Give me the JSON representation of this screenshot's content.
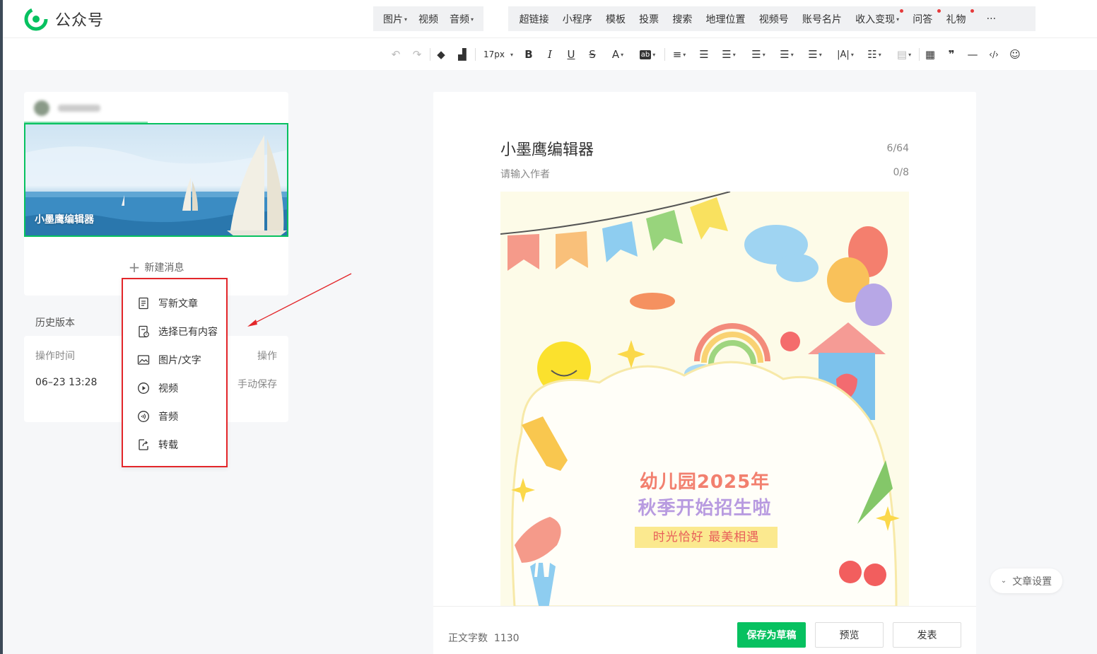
{
  "brand": {
    "name": "公众号",
    "color": "#07c160"
  },
  "media_menu": [
    "图片",
    "视频",
    "音频"
  ],
  "media_has_dropdown": [
    true,
    false,
    true
  ],
  "insert_menu": [
    {
      "label": "超链接",
      "dot": false
    },
    {
      "label": "小程序",
      "dot": false
    },
    {
      "label": "模板",
      "dot": false
    },
    {
      "label": "投票",
      "dot": false
    },
    {
      "label": "搜索",
      "dot": false
    },
    {
      "label": "地理位置",
      "dot": false
    },
    {
      "label": "视频号",
      "dot": false
    },
    {
      "label": "账号名片",
      "dot": false
    },
    {
      "label": "收入变现",
      "dot": true
    },
    {
      "label": "问答",
      "dot": true
    },
    {
      "label": "礼物",
      "dot": true
    },
    {
      "label": "···",
      "dot": false
    }
  ],
  "toolbar": {
    "font_size": "17px"
  },
  "left_panel": {
    "cover_title": "小墨鹰编辑器",
    "new_message": "新建消息",
    "history_title": "历史版本",
    "history": {
      "col_time": "操作时间",
      "col_action": "操作",
      "rows": [
        {
          "time": "06–23 13:28",
          "action": "手动保存"
        }
      ]
    }
  },
  "dropdown": {
    "items": [
      {
        "icon": "document-icon",
        "label": "写新文章"
      },
      {
        "icon": "select-content-icon",
        "label": "选择已有内容"
      },
      {
        "icon": "image-icon",
        "label": "图片/文字"
      },
      {
        "icon": "video-play-icon",
        "label": "视频"
      },
      {
        "icon": "audio-icon",
        "label": "音频"
      },
      {
        "icon": "repost-icon",
        "label": "转载"
      }
    ]
  },
  "editor": {
    "title": "小墨鹰编辑器",
    "title_count": "6/64",
    "author_placeholder": "请输入作者",
    "author_count": "0/8",
    "poster": {
      "line1": "幼儿园2025年",
      "line2": "秋季开始招生啦",
      "line3": "时光恰好 最美相遇"
    }
  },
  "footer": {
    "word_count_label": "正文字数",
    "word_count": "1130",
    "save_draft": "保存为草稿",
    "preview": "预览",
    "publish": "发表"
  },
  "article_settings": "文章设置"
}
